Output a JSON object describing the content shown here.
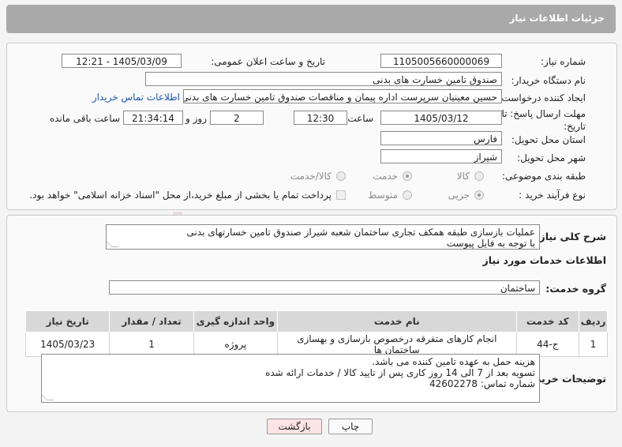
{
  "header": {
    "title": "جزئیات اطلاعات نیاز"
  },
  "form": {
    "need_number_label": "شماره نیاز:",
    "need_number": "1105005660000069",
    "announce_label": "تاریخ و ساعت اعلان عمومی:",
    "announce_value": "1405/03/09 - 12:21",
    "buyer_org_label": "نام دستگاه خریدار:",
    "buyer_org": "صندوق تامین خسارت های بدنی",
    "creator_label": "ایجاد کننده درخواست:",
    "creator": "حسین  معینیان سرپرست اداره پیمان و مناقصات صندوق تامین خسارت های بدنی",
    "contact_link": "اطلاعات تماس خریدار",
    "deadline_label_1": "مهلت ارسال پاسخ: تا",
    "deadline_label_2": "تاریخ:",
    "deadline_date": "1405/03/12",
    "time_label": "ساعت",
    "deadline_time": "12:30",
    "days_value": "2",
    "days_label": "روز و",
    "remaining_time": "21:34:14",
    "remaining_label": "ساعت باقی مانده",
    "province_label": "استان محل تحویل:",
    "province": "فارس",
    "city_label": "شهر محل تحویل:",
    "city": "شیراز",
    "category_label": "طبقه بندی موضوعی:",
    "category_options": [
      "کالا",
      "خدمت",
      "کالا/خدمت"
    ],
    "category_selected": "خدمت",
    "process_label": "نوع فرآیند خرید :",
    "process_options": [
      "جزیی",
      "متوسط"
    ],
    "process_selected": "جزیی",
    "payment_note": "پرداخت تمام یا بخشی از مبلغ خرید،از محل \"اسناد خزانه اسلامی\" خواهد بود."
  },
  "summary": {
    "label": "شرح کلی نیاز:",
    "lines": [
      "عملیات بازسازی طبقه همکف تجاری ساختمان شعبه شیراز صندوق تامین خسارتهای بدنی",
      "با توجه به فایل پیوست"
    ]
  },
  "services": {
    "section_title": "اطلاعات خدمات مورد نیاز",
    "group_label": "گروه خدمت:",
    "group_value": "ساختمان",
    "columns": [
      "ردیف",
      "کد خدمت",
      "نام خدمت",
      "واحد اندازه گیری",
      "تعداد / مقدار",
      "تاریخ نیاز"
    ],
    "rows": [
      [
        "1",
        "ج-44",
        "انجام کارهای متفرقه درخصوص بازسازی و بهسازی ساختمان ها",
        "پروژه",
        "1",
        "1405/03/23"
      ]
    ]
  },
  "buyer_notes": {
    "label": "توضیحات خریدار:",
    "lines": [
      "هزینه حمل به عهده تامین کننده می باشد.",
      "تسویه بعد از 7 الی 14 روز کاری پس از تایید کالا / خدمات ارائه شده",
      "شماره تماس: 42602278"
    ]
  },
  "buttons": {
    "print": "چاپ",
    "back": "بازگشت"
  },
  "watermark": {
    "text": "AriaTender.neT"
  },
  "colors": {
    "accent_header": "#a9a9a9",
    "link": "#1a56b0",
    "back_button": "#fde4e4"
  }
}
